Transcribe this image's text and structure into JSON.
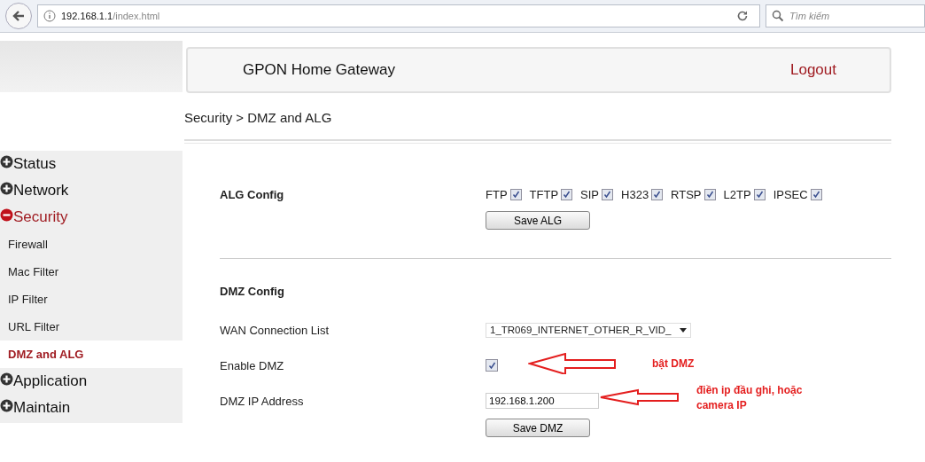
{
  "browser": {
    "url_host": "192.168.1.1",
    "url_path": "/index.html",
    "search": {
      "placeholder": "Tìm kiếm"
    }
  },
  "header": {
    "title": "GPON Home Gateway",
    "logout": "Logout"
  },
  "sidebar": {
    "items": [
      {
        "label": "Status",
        "expanded": false,
        "selected": false
      },
      {
        "label": "Network",
        "expanded": false,
        "selected": false
      },
      {
        "label": "Security",
        "expanded": true,
        "selected": true,
        "children": [
          {
            "label": "Firewall",
            "selected": false
          },
          {
            "label": "Mac Filter",
            "selected": false
          },
          {
            "label": "IP Filter",
            "selected": false
          },
          {
            "label": "URL Filter",
            "selected": false
          },
          {
            "label": "DMZ and ALG",
            "selected": true
          }
        ]
      },
      {
        "label": "Application",
        "expanded": false,
        "selected": false
      },
      {
        "label": "Maintain",
        "expanded": false,
        "selected": false
      }
    ]
  },
  "breadcrumb": "Security > DMZ and ALG",
  "alg": {
    "title": "ALG Config",
    "protocols": [
      {
        "label": "FTP",
        "checked": true
      },
      {
        "label": "TFTP",
        "checked": true
      },
      {
        "label": "SIP",
        "checked": true
      },
      {
        "label": "H323",
        "checked": true
      },
      {
        "label": "RTSP",
        "checked": true
      },
      {
        "label": "L2TP",
        "checked": true
      },
      {
        "label": "IPSEC",
        "checked": true
      }
    ],
    "button": "Save ALG"
  },
  "dmz": {
    "title": "DMZ Config",
    "wan_label": "WAN Connection List",
    "wan_value": "1_TR069_INTERNET_OTHER_R_VID_",
    "enable_label": "Enable DMZ",
    "enable_checked": true,
    "ip_label": "DMZ IP Address",
    "ip_value": "192.168.1.200",
    "button": "Save DMZ"
  },
  "annotations": [
    {
      "text": "bật DMZ"
    },
    {
      "text": "điền ip đầu ghi, hoặc camera IP"
    }
  ]
}
